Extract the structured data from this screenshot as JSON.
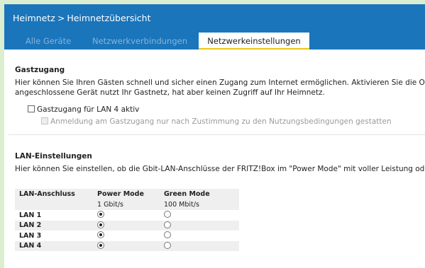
{
  "header": {
    "breadcrumb": [
      "Heimnetz",
      "Heimnetzübersicht"
    ],
    "separator": ">",
    "tabs": [
      {
        "label": "Alle Geräte",
        "active": false
      },
      {
        "label": "Netzwerkverbindungen",
        "active": false
      },
      {
        "label": "Netzwerkeinstellungen",
        "active": true
      }
    ]
  },
  "guest": {
    "title": "Gastzugang",
    "text_line1": "Hier können Sie Ihren Gästen schnell und sicher einen Zugang zum Internet ermöglichen. Aktivieren Sie die Option \"",
    "text_line2": "angeschlossene Gerät nutzt Ihr Gastnetz, hat aber keinen Zugriff auf Ihr Heimnetz.",
    "checkbox_label": "Gastzugang für LAN 4 aktiv",
    "checkbox_checked": false,
    "sub_checkbox_label": "Anmeldung am Gastzugang nur nach Zustimmung zu den Nutzungsbedingungen gestatten",
    "sub_checkbox_checked": false,
    "sub_checkbox_disabled": true
  },
  "lan": {
    "title": "LAN-Einstellungen",
    "text": "Hier können Sie einstellen, ob die Gbit-LAN-Anschlüsse der FRITZ!Box im \"Power Mode\" mit voller Leistung oder im \"",
    "columns": [
      "LAN-Anschluss",
      "Power Mode",
      "Green Mode"
    ],
    "subheaders": [
      "",
      "1 Gbit/s",
      "100 Mbit/s"
    ],
    "rows": [
      {
        "port": "LAN 1",
        "mode": "power"
      },
      {
        "port": "LAN 2",
        "mode": "power"
      },
      {
        "port": "LAN 3",
        "mode": "power"
      },
      {
        "port": "LAN 4",
        "mode": "power"
      }
    ]
  },
  "colors": {
    "header_bg": "#1a75bb",
    "tab_inactive_text": "#84b4dd",
    "active_tab_underline": "#e6c81c",
    "outer_bg": "#dbeecf"
  }
}
